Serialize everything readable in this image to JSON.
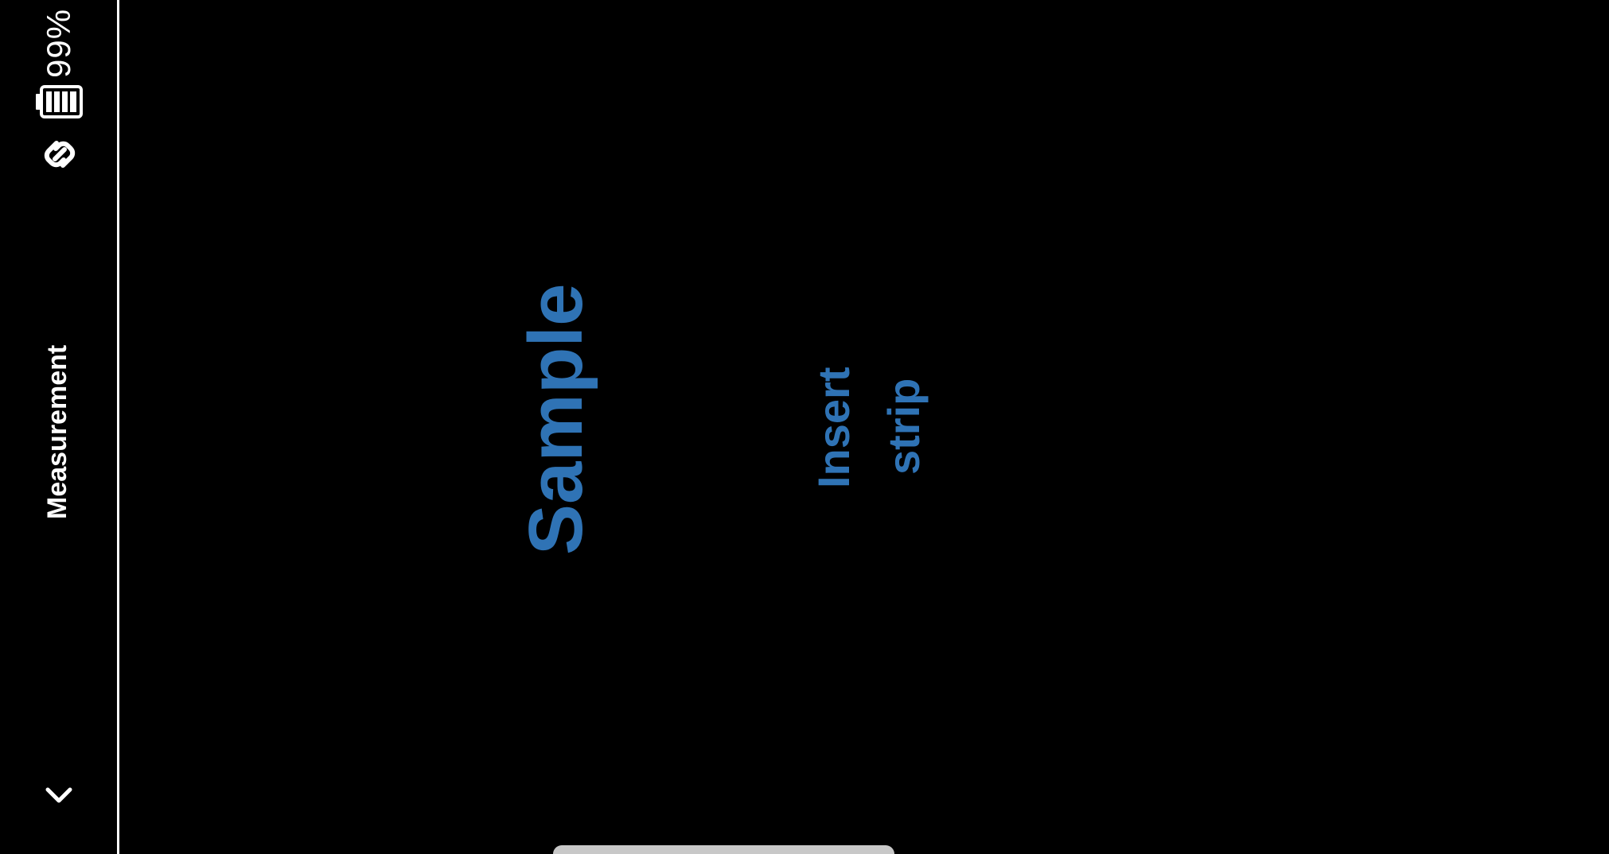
{
  "status_bar": {
    "battery_percent": "99%",
    "battery_level": 0.99,
    "connection_icon": "link-icon",
    "battery_icon": "battery-icon"
  },
  "sidebar": {
    "title": "Measurement",
    "collapse_icon": "chevron-down-icon"
  },
  "main": {
    "sample_label": "Sample",
    "instruction_line1": "Insert",
    "instruction_line2": "strip"
  },
  "colors": {
    "background": "#000000",
    "accent_blue": "#2f73b5",
    "foreground": "#ffffff",
    "handle": "#c8c8c8"
  }
}
